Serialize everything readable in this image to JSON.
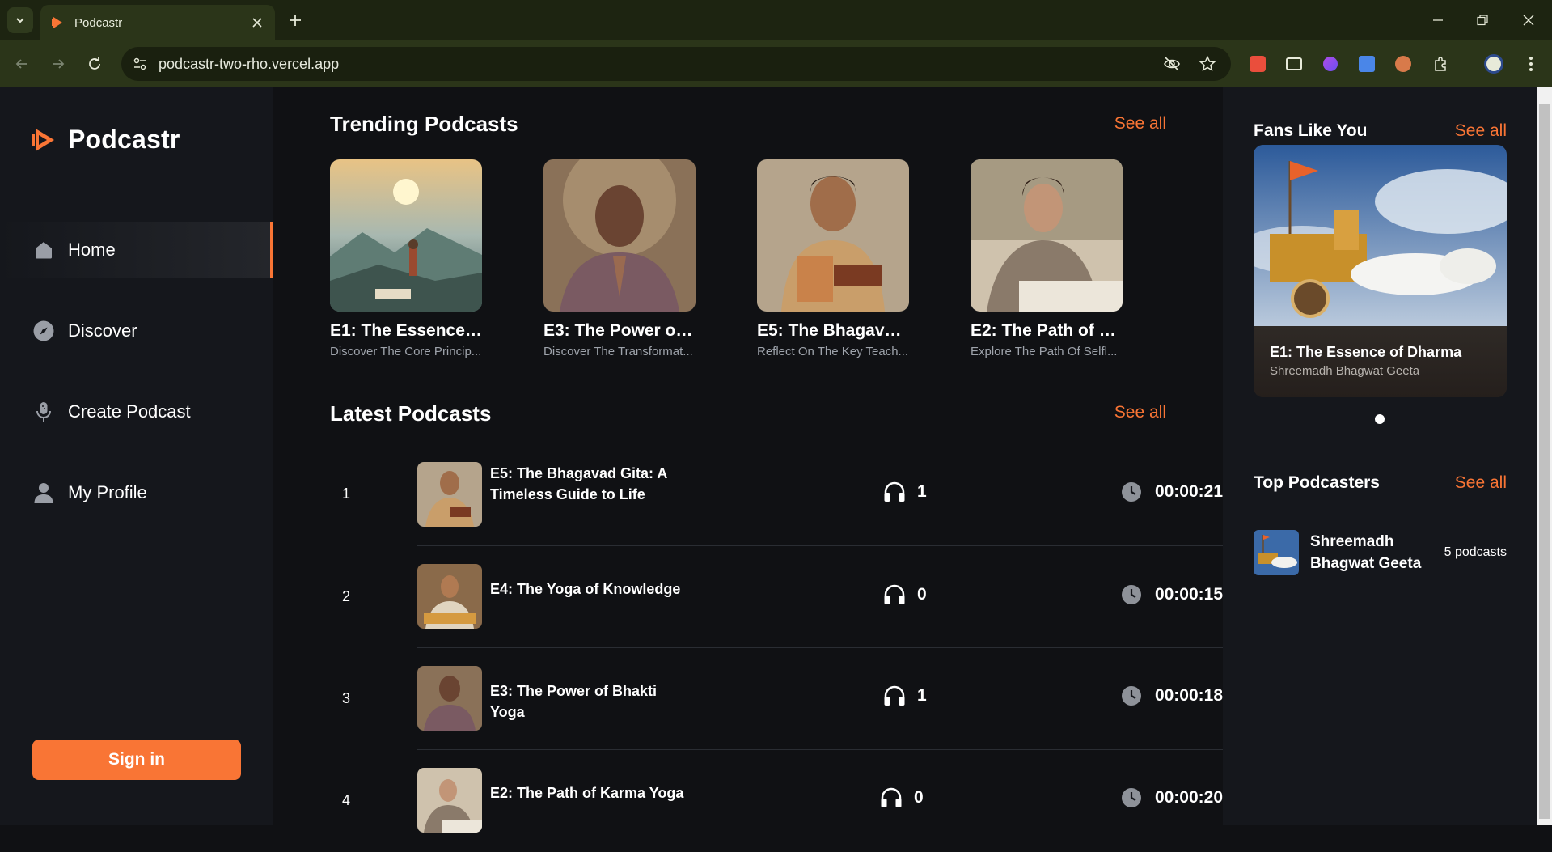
{
  "browser": {
    "tab_title": "Podcastr",
    "url": "podcastr-two-rho.vercel.app"
  },
  "app": {
    "name": "Podcastr",
    "nav": [
      {
        "label": "Home",
        "icon": "home-icon",
        "active": true
      },
      {
        "label": "Discover",
        "icon": "compass-icon",
        "active": false
      },
      {
        "label": "Create Podcast",
        "icon": "microphone-icon",
        "active": false
      },
      {
        "label": "My Profile",
        "icon": "user-icon",
        "active": false
      }
    ],
    "signin_label": "Sign in",
    "accent_color": "#f97535"
  },
  "trending": {
    "title": "Trending Podcasts",
    "see_all": "See all",
    "items": [
      {
        "title": "E1: The Essence o...",
        "desc": "Discover The Core Princip..."
      },
      {
        "title": "E3: The Power of ...",
        "desc": "Discover The Transformat..."
      },
      {
        "title": "E5: The Bhagavad...",
        "desc": "Reflect On The Key Teach..."
      },
      {
        "title": "E2: The Path of Ka...",
        "desc": "Explore The Path Of Selfl..."
      }
    ]
  },
  "latest": {
    "title": "Latest Podcasts",
    "see_all": "See all",
    "rows": [
      {
        "num": "1",
        "title": "E5: The Bhagavad Gita: A Timeless Guide to Life",
        "listens": "1",
        "duration": "00:00:21"
      },
      {
        "num": "2",
        "title": "E4: The Yoga of Knowledge",
        "listens": "0",
        "duration": "00:00:15"
      },
      {
        "num": "3",
        "title": "E3: The Power of Bhakti Yoga",
        "listens": "1",
        "duration": "00:00:18"
      },
      {
        "num": "4",
        "title": "E2: The Path of Karma Yoga",
        "listens": "0",
        "duration": "00:00:20"
      }
    ]
  },
  "fans": {
    "title": "Fans Like You",
    "see_all": "See all",
    "card_title": "E1: The Essence of Dharma",
    "card_sub": "Shreemadh Bhagwat Geeta"
  },
  "top_podcasters": {
    "title": "Top Podcasters",
    "see_all": "See all",
    "items": [
      {
        "name": "Shreemadh Bhagwat Geeta",
        "count": "5 podcasts"
      }
    ]
  }
}
